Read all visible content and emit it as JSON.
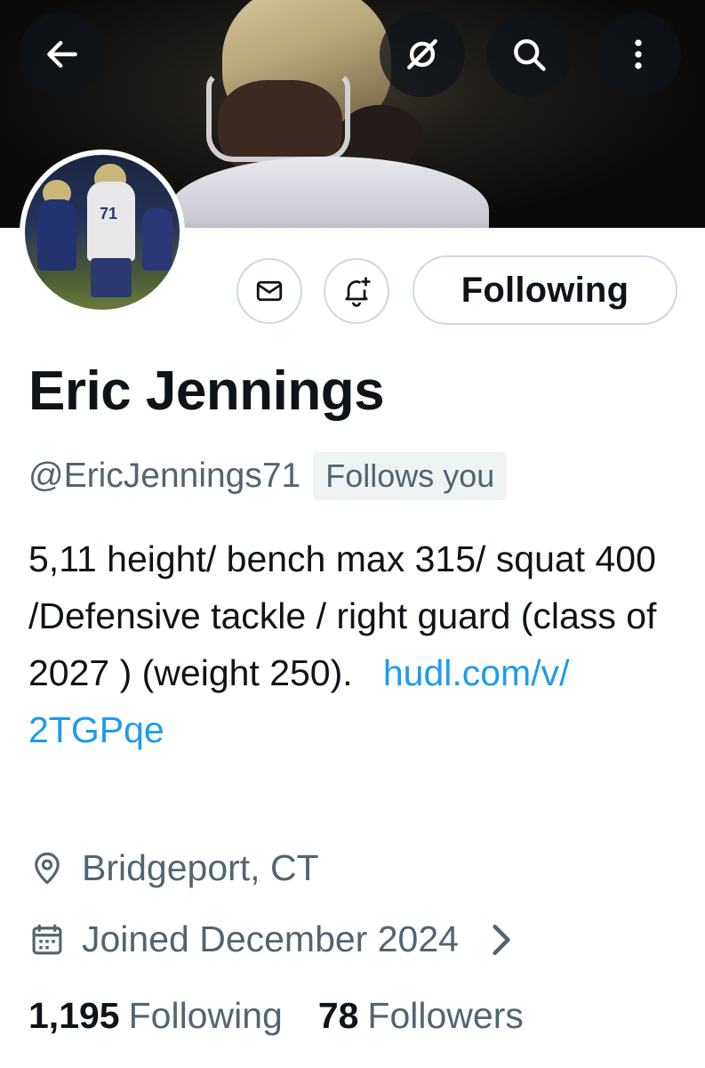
{
  "header": {
    "back_icon": "arrow-left-icon",
    "grok_icon": "slashed-circle-icon",
    "search_icon": "search-icon",
    "more_icon": "more-vertical-icon"
  },
  "actions": {
    "message_icon": "envelope-icon",
    "notify_icon": "bell-plus-icon",
    "follow_label": "Following"
  },
  "profile": {
    "name": "Eric Jennings",
    "handle": "@EricJennings71",
    "follows_you": "Follows you",
    "bio_text": "5,11 height/ bench max 315/ squat 400 /Defensive tackle / right guard (class of 2027 ) (weight 250).",
    "bio_link_part1": "hudl.com/v/",
    "bio_link_part2": "2TGPqe",
    "location": "Bridgeport, CT",
    "joined": "Joined December 2024"
  },
  "stats": {
    "following_count": "1,195",
    "following_label": "Following",
    "followers_count": "78",
    "followers_label": "Followers"
  },
  "colors": {
    "text": "#0f1419",
    "secondary": "#536471",
    "link": "#1d9bf0",
    "border": "#cfd9de"
  }
}
